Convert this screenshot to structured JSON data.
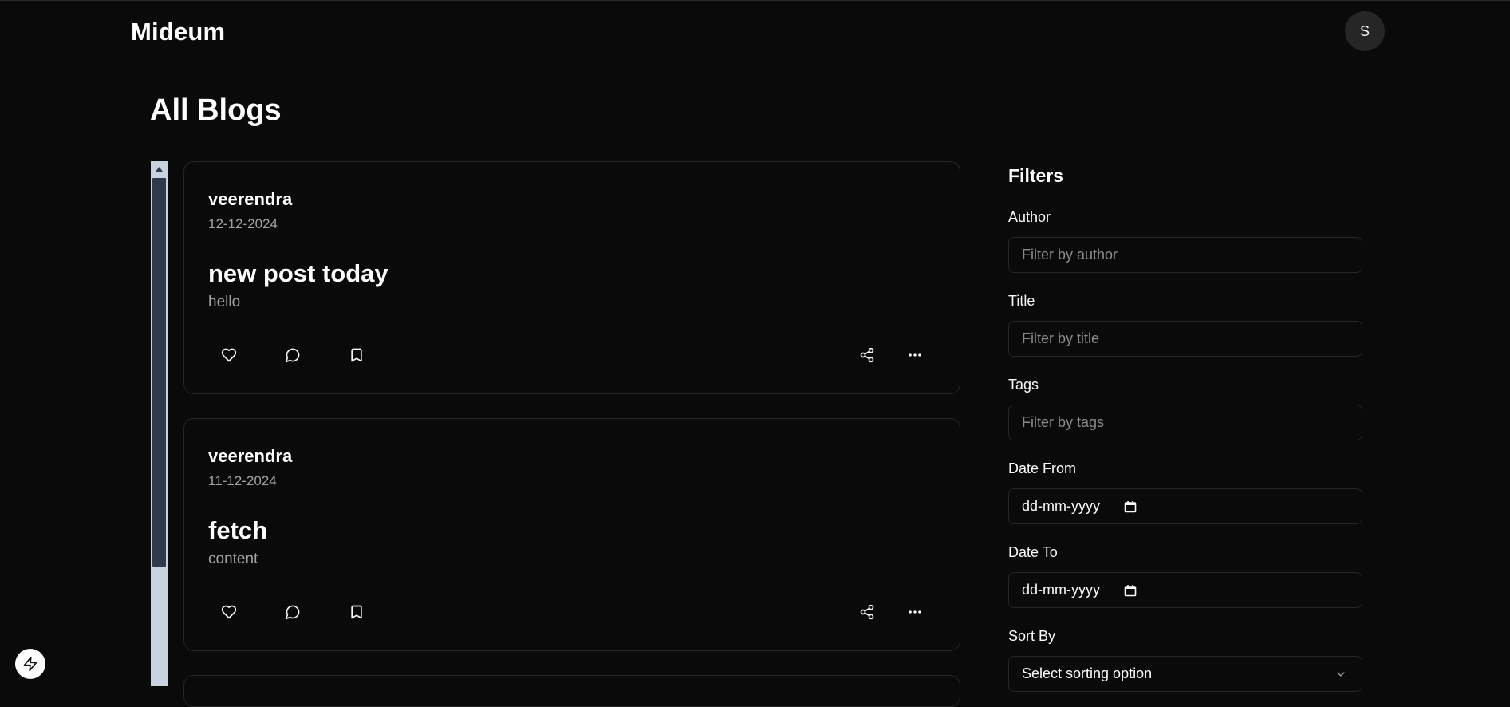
{
  "header": {
    "brand": "Mideum",
    "avatar_initial": "S"
  },
  "page": {
    "title": "All Blogs"
  },
  "posts": [
    {
      "author": "veerendra",
      "date": "12-12-2024",
      "title": "new post today",
      "excerpt": "hello"
    },
    {
      "author": "veerendra",
      "date": "11-12-2024",
      "title": "fetch",
      "excerpt": "content"
    }
  ],
  "icons": {
    "like": "heart-icon",
    "comment": "message-circle-icon",
    "save": "bookmark-icon",
    "share": "share-icon",
    "more": "ellipsis-icon",
    "calendar": "calendar-icon",
    "chevron": "chevron-down-icon",
    "devtools": "bolt-icon"
  },
  "filters": {
    "title": "Filters",
    "author": {
      "label": "Author",
      "placeholder": "Filter by author"
    },
    "title_field": {
      "label": "Title",
      "placeholder": "Filter by title"
    },
    "tags": {
      "label": "Tags",
      "placeholder": "Filter by tags"
    },
    "date_from": {
      "label": "Date From",
      "value": "dd-mm-yyyy"
    },
    "date_to": {
      "label": "Date To",
      "value": "dd-mm-yyyy"
    },
    "sort": {
      "label": "Sort By",
      "value": "Select sorting option"
    }
  },
  "colors": {
    "background": "#0a0a0a",
    "border": "#262626",
    "muted_text": "#a3a3a3",
    "scroll_track": "#c9d3e0",
    "scroll_thumb": "#2f3a4a"
  }
}
